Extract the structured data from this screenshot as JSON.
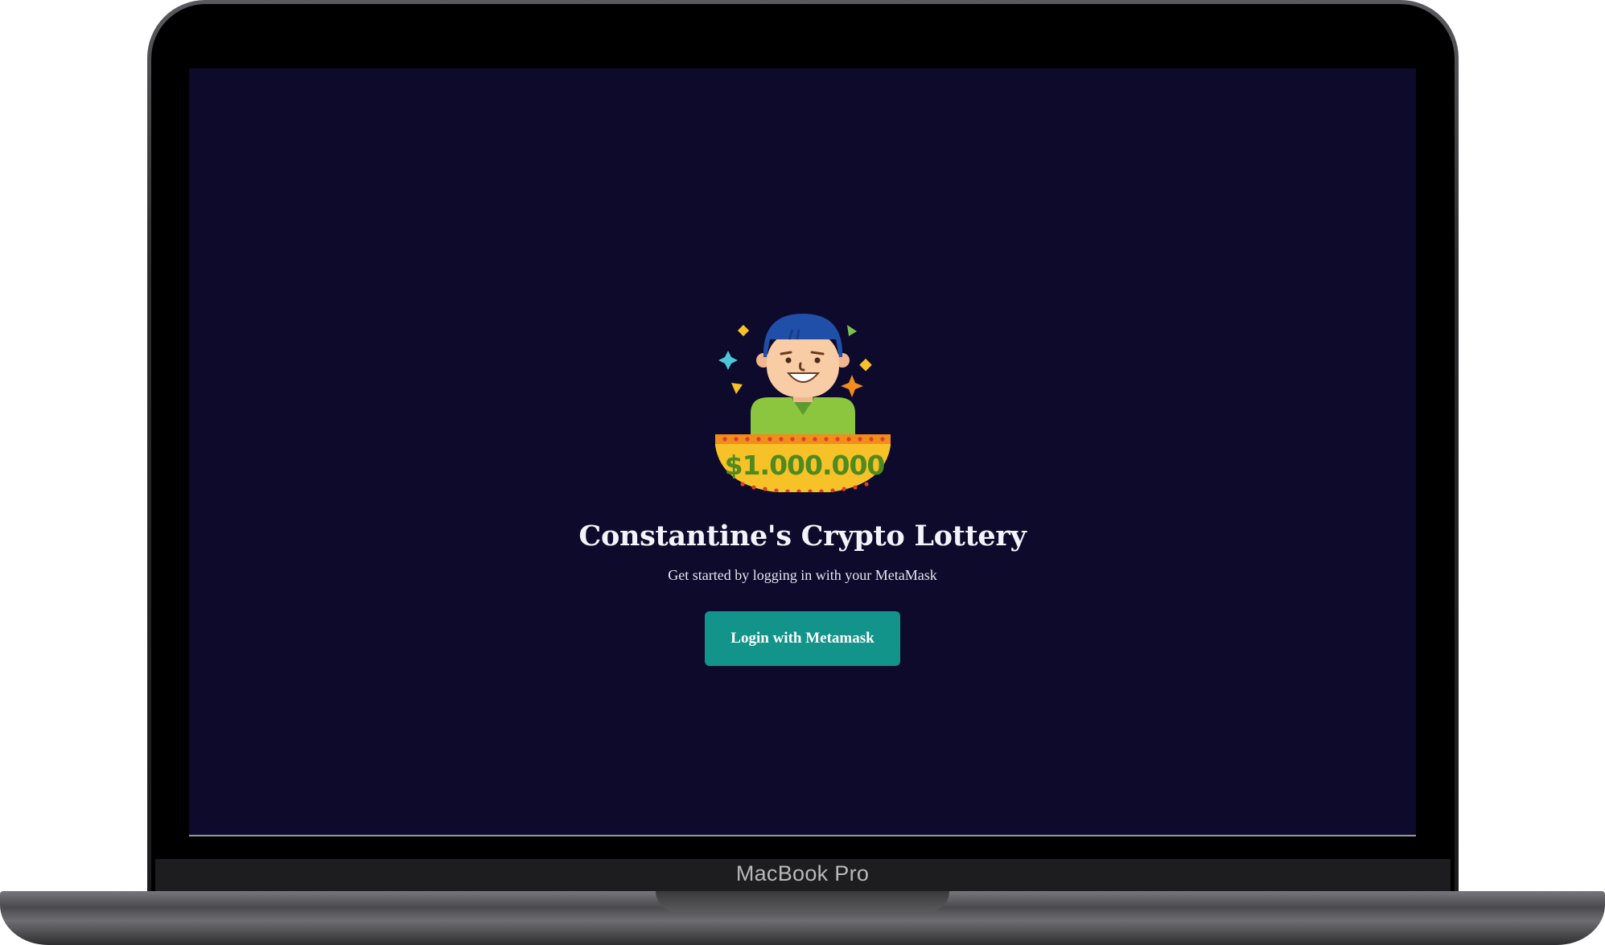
{
  "device": {
    "label": "MacBook Pro"
  },
  "hero": {
    "illustration_icon": "lottery-winner-icon",
    "prize_text": "$1.000.000"
  },
  "page": {
    "title": "Constantine's Crypto Lottery",
    "subtitle": "Get started by logging in with your MetaMask",
    "login_label": "Login with Metamask"
  },
  "colors": {
    "screen_background": "#0d0a2c",
    "button_background": "#13948a",
    "text": "#f4f3fb"
  }
}
